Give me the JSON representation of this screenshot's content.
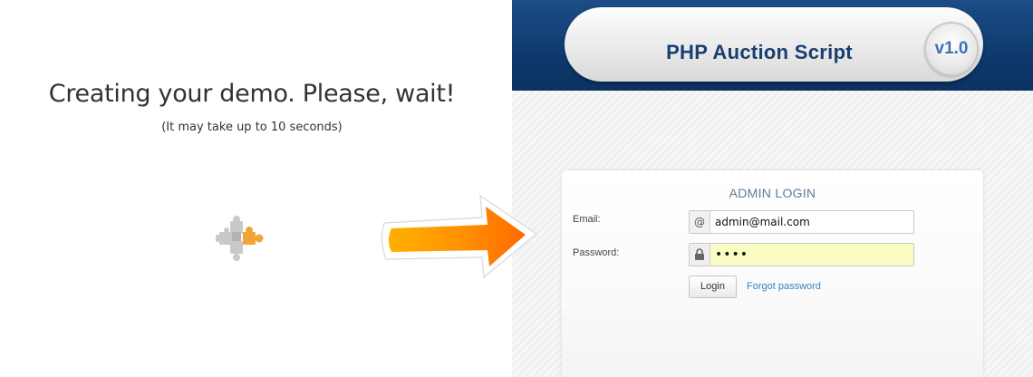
{
  "demo": {
    "title": "Creating your demo. Please, wait!",
    "subtitle": "(It may take up to 10 seconds)"
  },
  "banner": {
    "title": "PHP Auction Script",
    "version": "v1.0"
  },
  "login": {
    "title": "ADMIN LOGIN",
    "email_label": "Email:",
    "email_value": "admin@mail.com",
    "email_icon": "@",
    "password_label": "Password:",
    "password_value": "••••",
    "login_button": "Login",
    "forgot_link": "Forgot password"
  },
  "colors": {
    "banner_blue": "#0f3a6d",
    "title_blue": "#173f72",
    "version_blue": "#3a74b3",
    "link_blue": "#3a7fc0",
    "arrow_orange": "#ff8a00",
    "password_bg": "#fbfbc4"
  },
  "icons": [
    "puzzle-loader-icon",
    "arrow-right-icon",
    "at-sign-icon",
    "lock-icon"
  ]
}
